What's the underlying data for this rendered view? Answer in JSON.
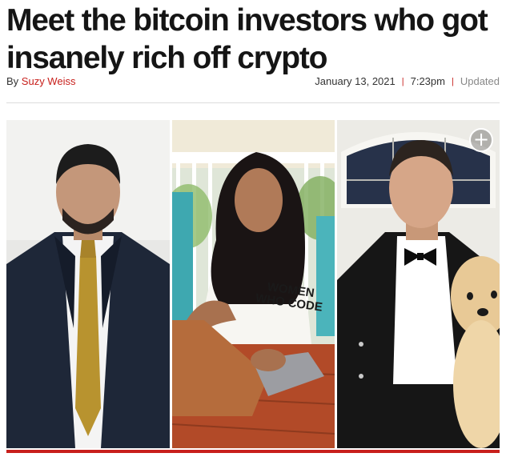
{
  "article": {
    "headline": "Meet the bitcoin investors who got insanely rich off crypto",
    "byline_prefix": "By",
    "author": "Suzy Weiss",
    "date": "January 13, 2021",
    "time": "7:23pm",
    "separator": "|",
    "updated_label": "Updated"
  },
  "gallery": {
    "expand_icon": "plus-circle-icon",
    "expand_glyph": "+",
    "shirt_text_line1": "WOMEN",
    "shirt_text_line2": "WHO CODE",
    "photos": [
      "man-in-suit-photo",
      "woman-with-laptop-photo",
      "man-with-puppy-photo"
    ]
  },
  "colors": {
    "accent": "#c8201c",
    "headline": "#151515",
    "rule": "#dcdcdc"
  }
}
